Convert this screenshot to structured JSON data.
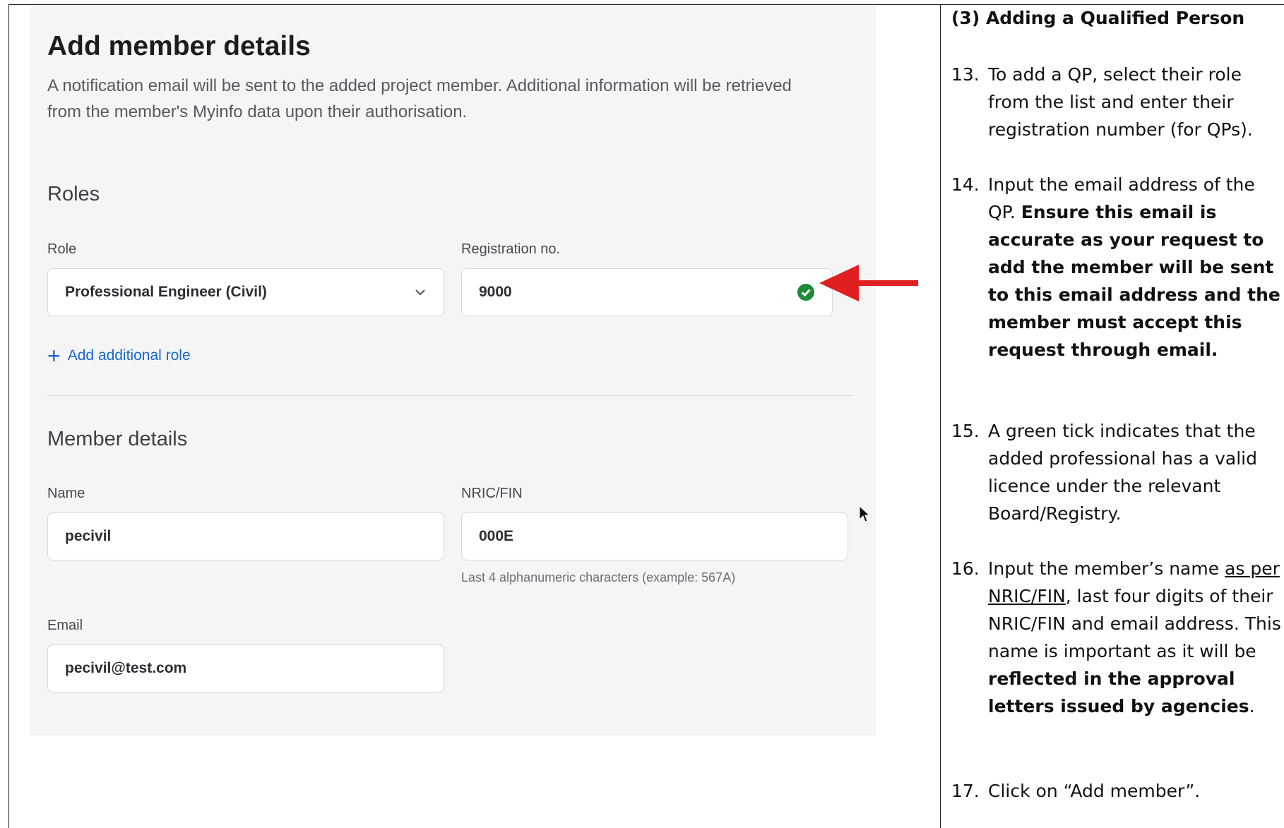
{
  "screenshot": {
    "title": "Add member details",
    "description": "A notification email will be sent to the added project member. Additional information will be retrieved from the member's Myinfo data upon their authorisation.",
    "roles_section": "Roles",
    "role_label": "Role",
    "role_value": "Professional Engineer (Civil)",
    "registration_label": "Registration no.",
    "registration_value": "9000",
    "add_role": "Add additional role",
    "member_section": "Member details",
    "name_label": "Name",
    "name_value": "pecivil",
    "nric_label": "NRIC/FIN",
    "nric_value": "000E",
    "nric_hint": "Last 4 alphanumeric characters (example: 567A)",
    "email_label": "Email",
    "email_value": "pecivil@test.com",
    "colors": {
      "link": "#1a66c9",
      "tick": "#1d8a3a",
      "arrow": "#e02020"
    }
  },
  "instructions": {
    "title": "(3)  Adding a Qualified Person",
    "steps": [
      {
        "num": "13.",
        "text": "To add a QP, select their role from the list and enter their registration number (for QPs)."
      },
      {
        "num": "14.",
        "lead": "Input the email address of the QP. ",
        "bold": "Ensure this email is accurate as your request to add the member will be sent to this email address and the member must accept this request through email."
      },
      {
        "num": "15.",
        "text": "A green tick indicates that the added professional has a valid licence under the relevant Board/Registry."
      },
      {
        "num": "16.",
        "lead": "Input the member’s name ",
        "underline": "as per NRIC/FIN",
        "mid": ", last four digits of their NRIC/FIN and email address. This name is important as it will be ",
        "bold": "reflected in the approval letters issued by agencies",
        "tail": "."
      },
      {
        "num": "17.",
        "text": "Click on “Add member”."
      }
    ]
  }
}
